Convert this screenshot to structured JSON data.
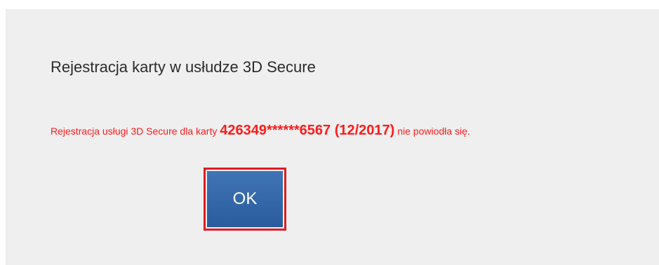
{
  "dialog": {
    "title": "Rejestracja karty w usłudze 3D Secure",
    "message_prefix": "Rejestracja usługi 3D Secure dla karty ",
    "card_info": "426349******6567 (12/2017)",
    "message_suffix": " nie powiodła się.",
    "ok_label": "OK"
  },
  "colors": {
    "panel_background": "#efefef",
    "error_text": "#ff1a1a",
    "button_background": "#2f66a8",
    "highlight_border": "#e01b24"
  }
}
